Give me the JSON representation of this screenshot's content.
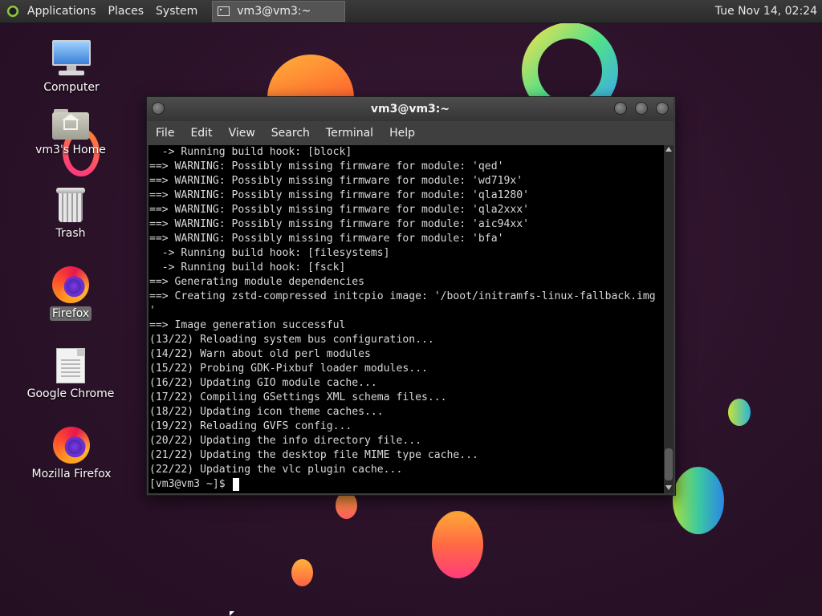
{
  "panel": {
    "menus": [
      "Applications",
      "Places",
      "System"
    ],
    "taskbar_item": "vm3@vm3:~",
    "clock": "Tue Nov 14, 02:24"
  },
  "desktop_icons": [
    {
      "label": "Computer",
      "icon": "computer-icon"
    },
    {
      "label": "vm3's Home",
      "icon": "home-folder-icon"
    },
    {
      "label": "Trash",
      "icon": "trash-icon"
    },
    {
      "label": "Firefox",
      "icon": "firefox-icon",
      "selected": true
    },
    {
      "label": "Google Chrome",
      "icon": "document-icon"
    },
    {
      "label": "Mozilla Firefox",
      "icon": "firefox-icon"
    }
  ],
  "terminal": {
    "title": "vm3@vm3:~",
    "menu": [
      "File",
      "Edit",
      "View",
      "Search",
      "Terminal",
      "Help"
    ],
    "lines": [
      "  -> Running build hook: [block]",
      "==> WARNING: Possibly missing firmware for module: 'qed'",
      "==> WARNING: Possibly missing firmware for module: 'wd719x'",
      "==> WARNING: Possibly missing firmware for module: 'qla1280'",
      "==> WARNING: Possibly missing firmware for module: 'qla2xxx'",
      "==> WARNING: Possibly missing firmware for module: 'aic94xx'",
      "==> WARNING: Possibly missing firmware for module: 'bfa'",
      "  -> Running build hook: [filesystems]",
      "  -> Running build hook: [fsck]",
      "==> Generating module dependencies",
      "==> Creating zstd-compressed initcpio image: '/boot/initramfs-linux-fallback.img",
      "'",
      "==> Image generation successful",
      "(13/22) Reloading system bus configuration...",
      "(14/22) Warn about old perl modules",
      "(15/22) Probing GDK-Pixbuf loader modules...",
      "(16/22) Updating GIO module cache...",
      "(17/22) Compiling GSettings XML schema files...",
      "(18/22) Updating icon theme caches...",
      "(19/22) Reloading GVFS config...",
      "(20/22) Updating the info directory file...",
      "(21/22) Updating the desktop file MIME type cache...",
      "(22/22) Updating the vlc plugin cache..."
    ],
    "prompt": "[vm3@vm3 ~]$ "
  }
}
